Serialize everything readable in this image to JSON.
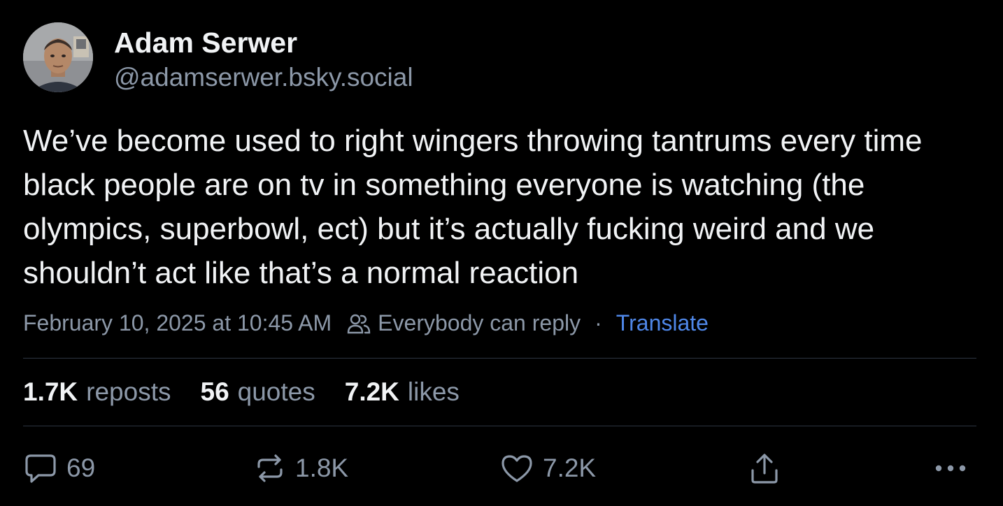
{
  "author": {
    "display_name": "Adam Serwer",
    "handle": "@adamserwer.bsky.social"
  },
  "post": {
    "text": "We’ve become used to right wingers throwing tantrums every time black people are on tv in something everyone is watching (the olympics, superbowl, ect) but it’s actually fucking weird and we shouldn’t act like that’s a normal reaction",
    "timestamp": "February 10, 2025 at 10:45 AM",
    "reply_setting": "Everybody can reply",
    "separator": "·",
    "translate_label": "Translate"
  },
  "stats": {
    "reposts_count": "1.7K",
    "reposts_label": "reposts",
    "quotes_count": "56",
    "quotes_label": "quotes",
    "likes_count": "7.2K",
    "likes_label": "likes"
  },
  "actions": {
    "reply_count": "69",
    "repost_count": "1.8K",
    "like_count": "7.2K"
  },
  "colors": {
    "background": "#000000",
    "text_primary": "#f1f3f5",
    "text_secondary": "#8c98a8",
    "link": "#4f87e8",
    "divider": "#2e3642"
  }
}
